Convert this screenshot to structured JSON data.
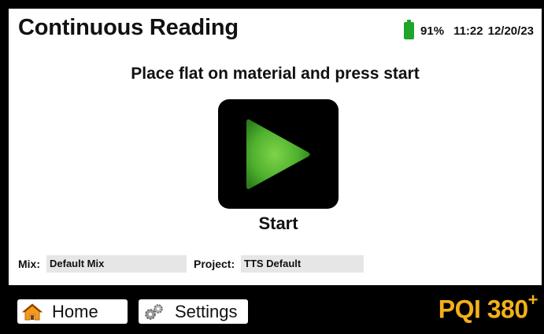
{
  "header": {
    "title": "Continuous Reading",
    "battery_percent": "91%",
    "battery_level": 0.91,
    "battery_color": "#1ea52a",
    "time": "11:22",
    "date": "12/20/23"
  },
  "main": {
    "instruction": "Place flat on material and press start",
    "start_label": "Start",
    "start_icon": "play-icon"
  },
  "fields": {
    "mix_label": "Mix:",
    "mix_value": "Default Mix",
    "project_label": "Project:",
    "project_value": "TTS Default"
  },
  "footer": {
    "home_label": "Home",
    "home_icon": "home-icon",
    "settings_label": "Settings",
    "settings_icon": "gears-icon",
    "brand_name": "PQI 380",
    "brand_sup": "+",
    "brand_color": "#f2b01b"
  }
}
